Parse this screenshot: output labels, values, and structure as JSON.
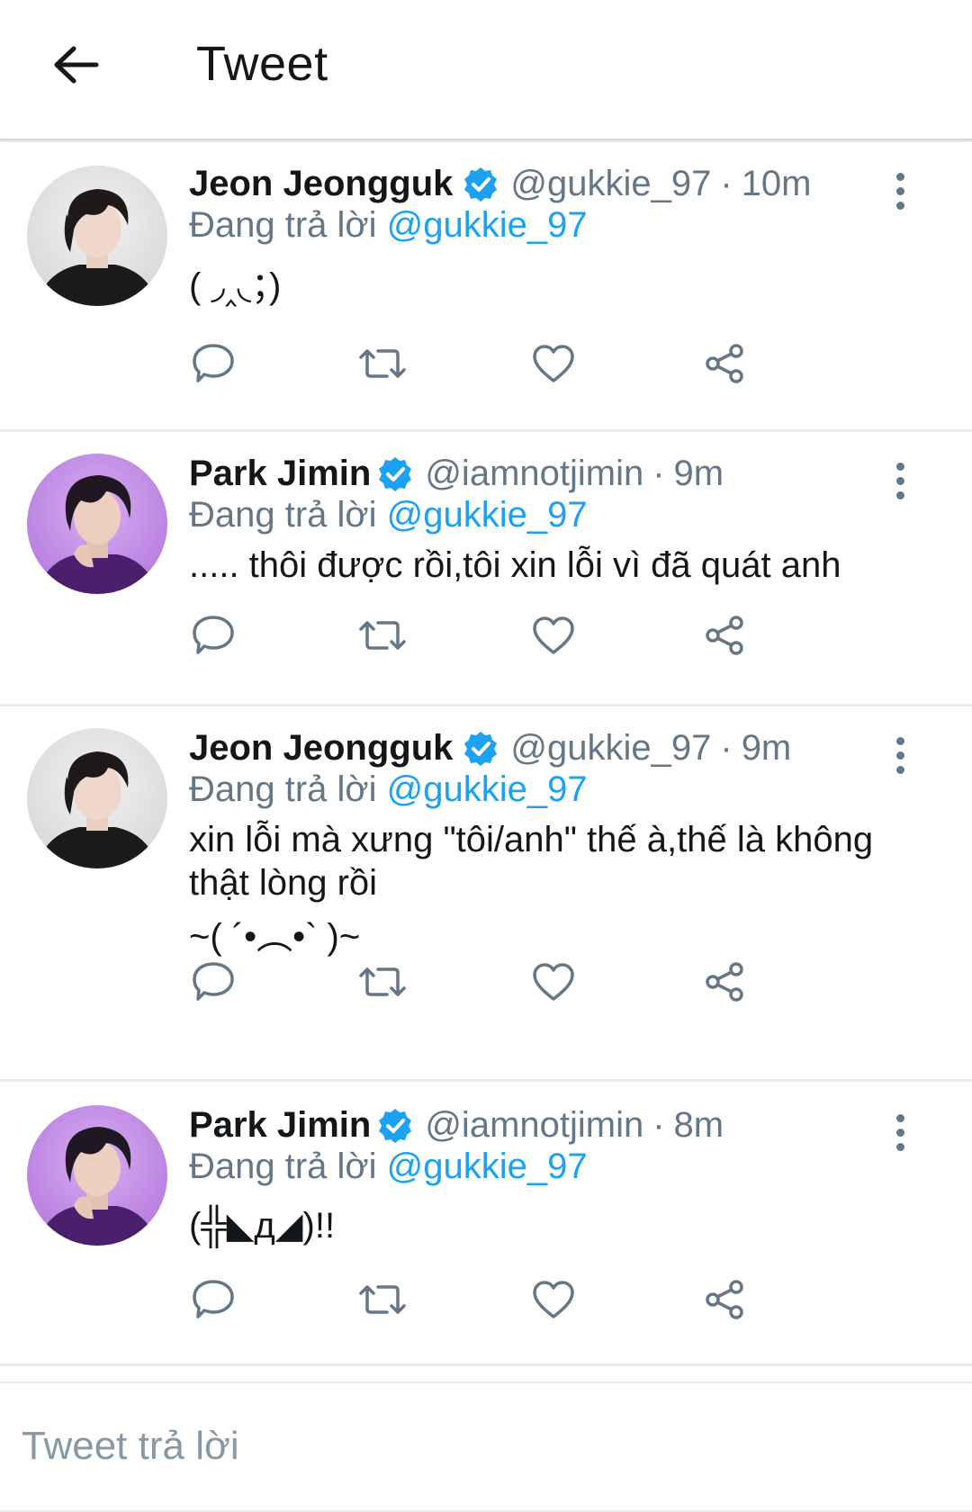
{
  "header": {
    "title": "Tweet",
    "back_icon": "arrow-left-icon"
  },
  "colors": {
    "accent": "#1da1f2",
    "muted": "#657786",
    "text": "#14171a",
    "divider": "#e6ecf0"
  },
  "tweets": [
    {
      "name": "Jeon Jeongguk",
      "handle": "@gukkie_97",
      "time": "10m",
      "reply_prefix": "Đang trả lời",
      "reply_to": "@gukkie_97",
      "lines": [
        "( ◞‸◟；)"
      ]
    },
    {
      "name": "Park Jimin",
      "handle": "@iamnotjimin",
      "time": "9m",
      "reply_prefix": "Đang trả lời",
      "reply_to": "@gukkie_97",
      "lines": [
        "..... thôi được rồi,tôi xin lỗi vì đã quát anh"
      ]
    },
    {
      "name": "Jeon Jeongguk",
      "handle": "@gukkie_97",
      "time": "9m",
      "reply_prefix": "Đang trả lời",
      "reply_to": "@gukkie_97",
      "lines": [
        "xin lỗi mà xưng \"tôi/anh\" thế à,thế là không",
        "thật lòng rồi",
        "~( ´•︵•` )~"
      ]
    },
    {
      "name": "Park Jimin",
      "handle": "@iamnotjimin",
      "time": "8m",
      "reply_prefix": "Đang trả lời",
      "reply_to": "@gukkie_97",
      "lines": [
        "(╬◣д◢)!!"
      ]
    }
  ],
  "reply_box": {
    "placeholder": "Tweet trả lời"
  }
}
